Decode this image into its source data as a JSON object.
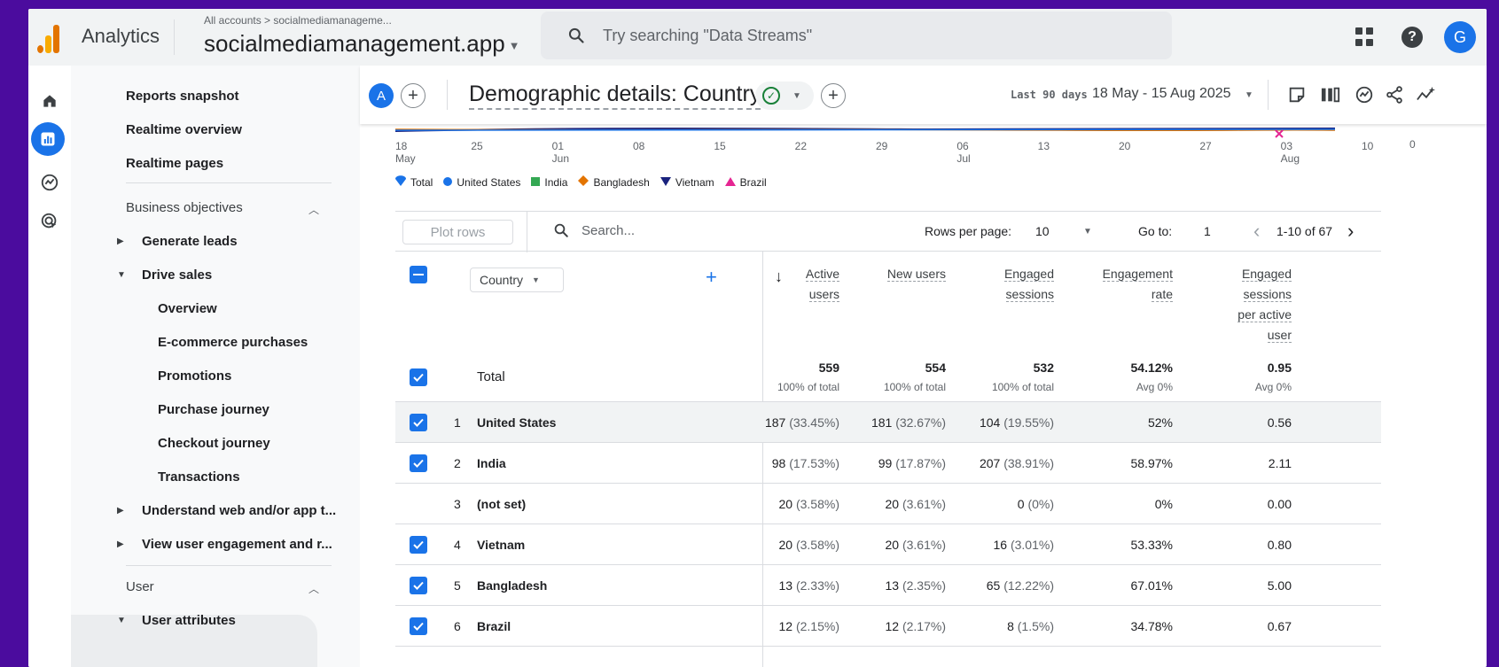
{
  "app": {
    "name": "Analytics"
  },
  "property": {
    "breadcrumb": "All accounts > socialmediamanageme...",
    "name": "socialmediamanagement.app"
  },
  "search": {
    "placeholder": "Try searching \"Data Streams\""
  },
  "user": {
    "avatar_initial": "G"
  },
  "sidebar": {
    "top_items": [
      "Reports snapshot",
      "Realtime overview",
      "Realtime pages"
    ],
    "section_business": "Business objectives",
    "business_items": [
      "Generate leads",
      "Drive sales"
    ],
    "drive_sales_items": [
      "Overview",
      "E-commerce purchases",
      "Promotions",
      "Purchase journey",
      "Checkout journey",
      "Transactions"
    ],
    "more_items": [
      "Understand web and/or app t...",
      "View user engagement and r..."
    ],
    "section_user": "User",
    "user_items": [
      "User attributes"
    ]
  },
  "report": {
    "compare_initial": "A",
    "title": "Demographic details: Country",
    "date_label": "Last 90 days",
    "date_range": "18 May - 15 Aug 2025"
  },
  "chart_data": {
    "type": "line",
    "x_ticks": [
      {
        "day": "18",
        "month": "May"
      },
      {
        "day": "25",
        "month": ""
      },
      {
        "day": "01",
        "month": "Jun"
      },
      {
        "day": "08",
        "month": ""
      },
      {
        "day": "15",
        "month": ""
      },
      {
        "day": "22",
        "month": ""
      },
      {
        "day": "29",
        "month": ""
      },
      {
        "day": "06",
        "month": "Jul"
      },
      {
        "day": "13",
        "month": ""
      },
      {
        "day": "20",
        "month": ""
      },
      {
        "day": "27",
        "month": ""
      },
      {
        "day": "03",
        "month": "Aug"
      },
      {
        "day": "10",
        "month": ""
      }
    ],
    "y_ticks_right": [
      "0"
    ],
    "legend": [
      {
        "name": "Total",
        "color": "#1a73e8",
        "shape": "pin"
      },
      {
        "name": "United States",
        "color": "#1a73e8",
        "shape": "circle"
      },
      {
        "name": "India",
        "color": "#34a853",
        "shape": "square"
      },
      {
        "name": "Bangladesh",
        "color": "#e37400",
        "shape": "diamond"
      },
      {
        "name": "Vietnam",
        "color": "#1a237e",
        "shape": "triangle-down"
      },
      {
        "name": "Brazil",
        "color": "#e52592",
        "shape": "triangle-up"
      }
    ]
  },
  "table": {
    "plot_rows_label": "Plot rows",
    "search_placeholder": "Search...",
    "rows_per_page_label": "Rows per page:",
    "rows_per_page": "10",
    "go_to_label": "Go to:",
    "go_to_value": "1",
    "pagination": "1-10 of 67",
    "dimension": "Country",
    "headers": {
      "active_users": [
        "Active",
        "users"
      ],
      "new_users": [
        "New users"
      ],
      "engaged_sessions": [
        "Engaged",
        "sessions"
      ],
      "engagement_rate": [
        "Engagement",
        "rate"
      ],
      "sessions_per_user": [
        "Engaged",
        "sessions",
        "per active",
        "user"
      ]
    },
    "total": {
      "label": "Total",
      "active_users": "559",
      "active_users_sub": "100% of total",
      "new_users": "554",
      "new_users_sub": "100% of total",
      "engaged_sessions": "532",
      "engaged_sessions_sub": "100% of total",
      "engagement_rate": "54.12%",
      "engagement_rate_sub": "Avg 0%",
      "sessions_per_user": "0.95",
      "sessions_per_user_sub": "Avg 0%"
    },
    "rows": [
      {
        "idx": "1",
        "country": "United States",
        "au": "187",
        "au_p": "(33.45%)",
        "nu": "181",
        "nu_p": "(32.67%)",
        "es": "104",
        "es_p": "(19.55%)",
        "er": "52%",
        "spu": "0.56"
      },
      {
        "idx": "2",
        "country": "India",
        "au": "98",
        "au_p": "(17.53%)",
        "nu": "99",
        "nu_p": "(17.87%)",
        "es": "207",
        "es_p": "(38.91%)",
        "er": "58.97%",
        "spu": "2.11"
      },
      {
        "idx": "3",
        "country": "(not set)",
        "au": "20",
        "au_p": "(3.58%)",
        "nu": "20",
        "nu_p": "(3.61%)",
        "es": "0",
        "es_p": "(0%)",
        "er": "0%",
        "spu": "0.00"
      },
      {
        "idx": "4",
        "country": "Vietnam",
        "au": "20",
        "au_p": "(3.58%)",
        "nu": "20",
        "nu_p": "(3.61%)",
        "es": "16",
        "es_p": "(3.01%)",
        "er": "53.33%",
        "spu": "0.80"
      },
      {
        "idx": "5",
        "country": "Bangladesh",
        "au": "13",
        "au_p": "(2.33%)",
        "nu": "13",
        "nu_p": "(2.35%)",
        "es": "65",
        "es_p": "(12.22%)",
        "er": "67.01%",
        "spu": "5.00"
      },
      {
        "idx": "6",
        "country": "Brazil",
        "au": "12",
        "au_p": "(2.15%)",
        "nu": "12",
        "nu_p": "(2.17%)",
        "es": "8",
        "es_p": "(1.5%)",
        "er": "34.78%",
        "spu": "0.67"
      }
    ]
  }
}
